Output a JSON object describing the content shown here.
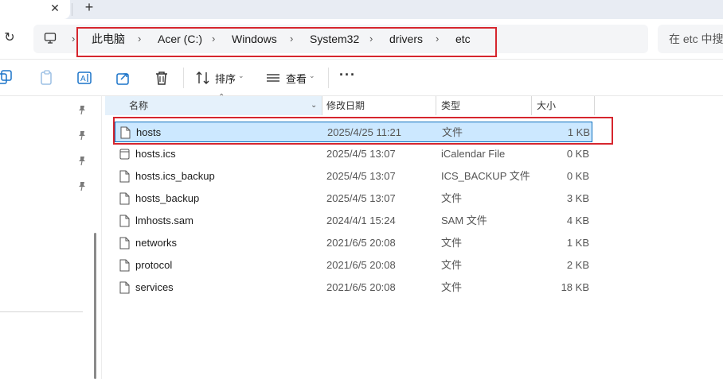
{
  "tabs": {
    "close_glyph": "✕",
    "new_glyph": "+"
  },
  "address": {
    "refresh_glyph": "↻",
    "breadcrumbs": [
      "此电脑",
      "Acer (C:)",
      "Windows",
      "System32",
      "drivers",
      "etc"
    ],
    "search_placeholder": "在 etc 中搜"
  },
  "toolbar": {
    "sort_label": "排序",
    "view_label": "查看",
    "more_label": "···",
    "icons": [
      "new-icon",
      "paste-icon",
      "rename-icon",
      "share-icon",
      "delete-icon",
      "sort-icon",
      "view-icon"
    ]
  },
  "columns": {
    "name": "名称",
    "modified": "修改日期",
    "type": "类型",
    "size": "大小"
  },
  "files": [
    {
      "name": "hosts",
      "modified": "2025/4/25 11:21",
      "type": "文件",
      "size": "1 KB",
      "selected": true,
      "icon": "file-icon"
    },
    {
      "name": "hosts.ics",
      "modified": "2025/4/5 13:07",
      "type": "iCalendar File",
      "size": "0 KB",
      "selected": false,
      "icon": "calendar-file-icon"
    },
    {
      "name": "hosts.ics_backup",
      "modified": "2025/4/5 13:07",
      "type": "ICS_BACKUP 文件",
      "size": "0 KB",
      "selected": false,
      "icon": "file-icon"
    },
    {
      "name": "hosts_backup",
      "modified": "2025/4/5 13:07",
      "type": "文件",
      "size": "3 KB",
      "selected": false,
      "icon": "file-icon"
    },
    {
      "name": "lmhosts.sam",
      "modified": "2024/4/1 15:24",
      "type": "SAM 文件",
      "size": "4 KB",
      "selected": false,
      "icon": "file-icon"
    },
    {
      "name": "networks",
      "modified": "2021/6/5 20:08",
      "type": "文件",
      "size": "1 KB",
      "selected": false,
      "icon": "file-icon"
    },
    {
      "name": "protocol",
      "modified": "2021/6/5 20:08",
      "type": "文件",
      "size": "2 KB",
      "selected": false,
      "icon": "file-icon"
    },
    {
      "name": "services",
      "modified": "2021/6/5 20:08",
      "type": "文件",
      "size": "18 KB",
      "selected": false,
      "icon": "file-icon"
    }
  ],
  "colors": {
    "highlight_red": "#d6262e",
    "selection_bg": "#cce8ff",
    "selection_border": "#0a6ebd",
    "accent_blue": "#1a73c9"
  }
}
